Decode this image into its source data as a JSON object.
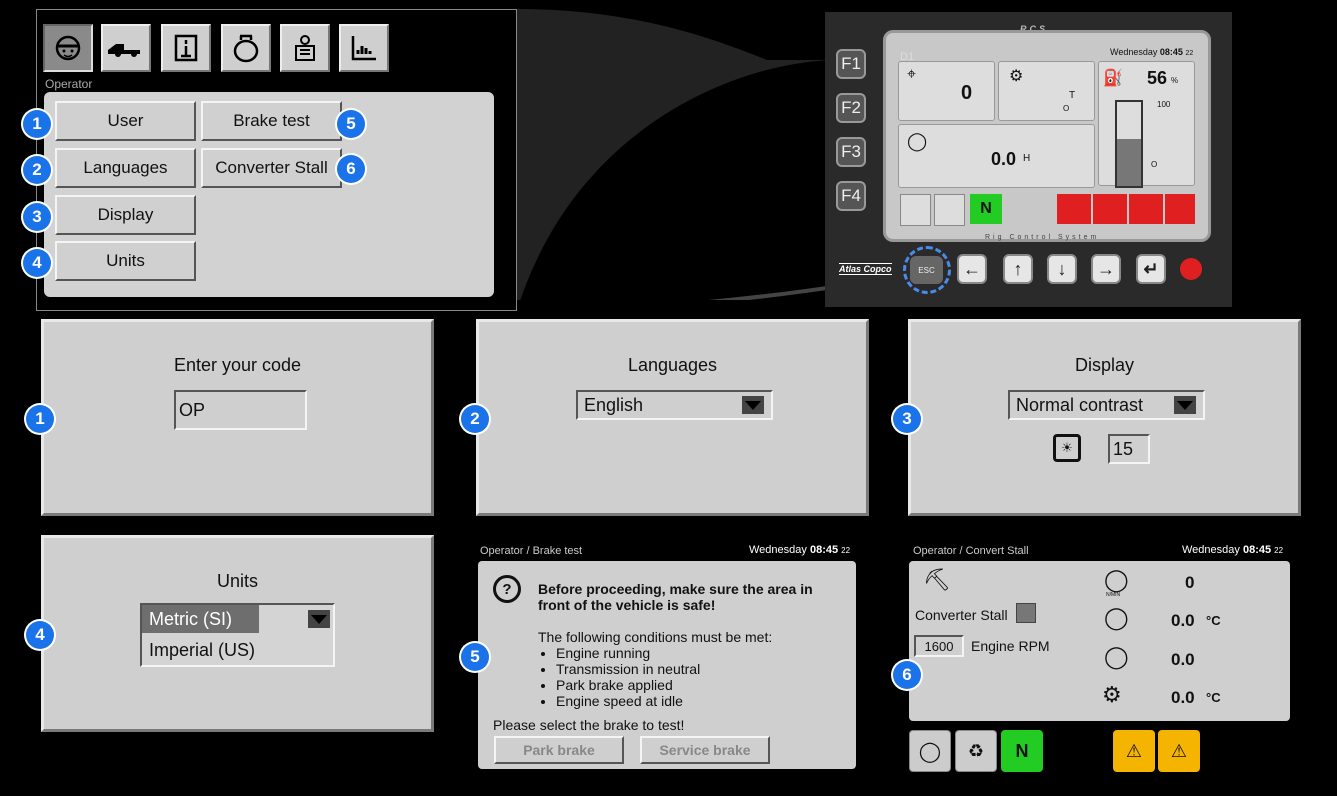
{
  "operator_menu": {
    "section_label": "Operator",
    "toolbar_icons": [
      "operator-helmet-icon",
      "drill-rig-icon",
      "checklist-icon",
      "engine-icon",
      "manual-icon",
      "bar-chart-icon"
    ],
    "buttons": {
      "user": "User",
      "languages": "Languages",
      "display": "Display",
      "units": "Units",
      "brake_test": "Brake test",
      "converter_stall": "Converter Stall"
    },
    "callouts": [
      "1",
      "2",
      "3",
      "4",
      "5",
      "6"
    ]
  },
  "device": {
    "brand_header": "RCS",
    "footer_label": "Rig Control System",
    "screen_id": "D1",
    "day": "Wednesday",
    "time": "08:45",
    "seconds": "22",
    "tile_drill_value": "0",
    "tile_second_unit": "T",
    "tile_second_sub": "O",
    "fuel_percent": "56",
    "fuel_unit": "%",
    "fuel_max": "100",
    "fuel_min": "O",
    "engine_hours": "0.0",
    "engine_hours_unit": "H",
    "neutral": "N",
    "fkeys": [
      "F1",
      "F2",
      "F3",
      "F4"
    ],
    "esc_label": "ESC",
    "logo": "Atlas Copco"
  },
  "code_screen": {
    "title": "Enter your code",
    "code_value": "OP",
    "callout": "1"
  },
  "languages_screen": {
    "title": "Languages",
    "selected": "English",
    "callout": "2"
  },
  "display_screen": {
    "title": "Display",
    "selected": "Normal contrast",
    "brightness": "15",
    "callout": "3"
  },
  "units_screen": {
    "title": "Units",
    "options": [
      "Metric (SI)",
      "Imperial (US)"
    ],
    "selected_index": 0,
    "callout": "4"
  },
  "brake_test_screen": {
    "breadcrumb": "Operator / Brake test",
    "day": "Wednesday",
    "time": "08:45",
    "seconds": "22",
    "warning": "Before proceeding, make sure the area in front of the vehicle is safe!",
    "conditions_intro": "The following conditions must be met:",
    "conditions": [
      "Engine running",
      "Transmission in neutral",
      "Park brake applied",
      "Engine speed at idle"
    ],
    "select_prompt": "Please select the brake to test!",
    "park_brake": "Park brake",
    "service_brake": "Service brake",
    "callout": "5"
  },
  "converter_stall_screen": {
    "breadcrumb": "Operator / Convert Stall",
    "day": "Wednesday",
    "time": "08:45",
    "seconds": "22",
    "converter_stall_label": "Converter Stall",
    "rpm_value": "1600",
    "rpm_label": "Engine RPM",
    "torque_value": "0",
    "torque_unit": "N/MIN",
    "engine_temp_value": "0.0",
    "engine_temp_unit": "°C",
    "engine_value": "0.0",
    "oil_temp_value": "0.0",
    "oil_temp_unit": "°C",
    "neutral": "N",
    "callout": "6"
  },
  "colors": {
    "callout_blue": "#1a73e8",
    "neutral_green": "#22cc22",
    "alarm_red": "#e02020",
    "warning_yellow": "#f4b400",
    "panel_gray": "#cfcfcf"
  }
}
